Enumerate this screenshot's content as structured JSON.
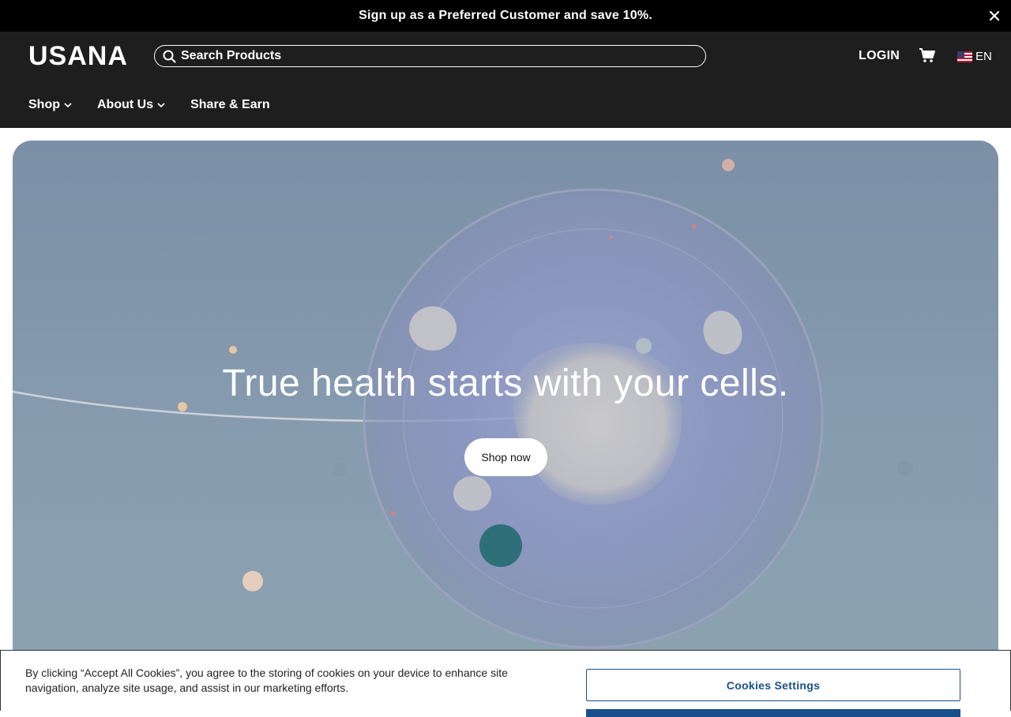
{
  "promo": {
    "text": "Sign up as a Preferred Customer and save 10%.",
    "close_icon": "close-icon"
  },
  "header": {
    "logo_text": "USANA",
    "search": {
      "placeholder": "Search Products",
      "icon": "search-icon"
    },
    "login_label": "LOGIN",
    "cart_icon": "cart-icon",
    "language": {
      "flag_icon": "us-flag-icon",
      "label": "EN"
    }
  },
  "nav": {
    "items": [
      {
        "label": "Shop",
        "has_dropdown": true
      },
      {
        "label": "About Us",
        "has_dropdown": true
      },
      {
        "label": "Share & Earn",
        "has_dropdown": false
      }
    ]
  },
  "hero": {
    "title": "True health starts with your cells.",
    "cta_label": "Shop now"
  },
  "cookie_banner": {
    "text": "By clicking “Accept All Cookies”, you agree to the storing of cookies on your device to enhance site navigation, analyze site usage, and assist in our marketing efforts.",
    "settings_label": "Cookies Settings"
  },
  "colors": {
    "header_bg": "#1e1e1f",
    "promo_bg": "#000000",
    "accent_blue": "#1a4f8b"
  }
}
